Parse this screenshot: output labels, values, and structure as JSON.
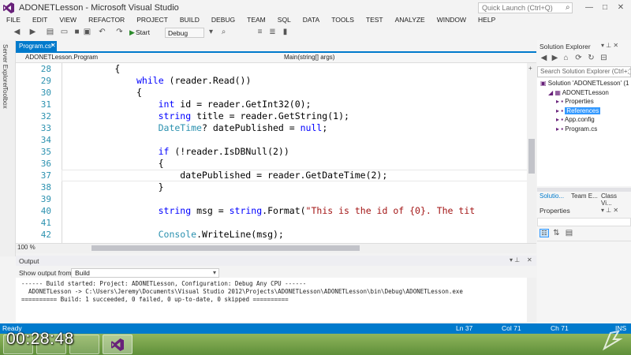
{
  "window": {
    "title": "ADONETLesson - Microsoft Visual Studio",
    "quick_launch_placeholder": "Quick Launch (Ctrl+Q)"
  },
  "menu": [
    "FILE",
    "EDIT",
    "VIEW",
    "REFACTOR",
    "PROJECT",
    "BUILD",
    "DEBUG",
    "TEAM",
    "SQL",
    "DATA",
    "TOOLS",
    "TEST",
    "ANALYZE",
    "WINDOW",
    "HELP"
  ],
  "toolbar": {
    "start_label": "Start",
    "config": "Debug"
  },
  "side_tabs": [
    "Server Explorer",
    "Toolbox"
  ],
  "editor": {
    "tab_label": "Program.cs*",
    "nav_left": "ADONETLesson.Program",
    "nav_right": "Main(string[] args)",
    "zoom": "100 %",
    "lines": [
      {
        "num": "28",
        "indent": 4,
        "parts": [
          {
            "t": "{",
            "c": "p"
          }
        ]
      },
      {
        "num": "29",
        "indent": 5,
        "parts": [
          {
            "t": "while",
            "c": "kw"
          },
          {
            "t": " (reader.Read())",
            "c": "p"
          }
        ]
      },
      {
        "num": "30",
        "indent": 5,
        "parts": [
          {
            "t": "{",
            "c": "p"
          }
        ]
      },
      {
        "num": "31",
        "indent": 6,
        "parts": [
          {
            "t": "int",
            "c": "kw"
          },
          {
            "t": " id = reader.GetInt32(0);",
            "c": "p"
          }
        ]
      },
      {
        "num": "32",
        "indent": 6,
        "parts": [
          {
            "t": "string",
            "c": "kw"
          },
          {
            "t": " title = reader.GetString(1);",
            "c": "p"
          }
        ]
      },
      {
        "num": "33",
        "indent": 6,
        "parts": [
          {
            "t": "DateTime",
            "c": "ty"
          },
          {
            "t": "? datePublished = ",
            "c": "p"
          },
          {
            "t": "null",
            "c": "kw"
          },
          {
            "t": ";",
            "c": "p"
          }
        ]
      },
      {
        "num": "34",
        "indent": 6,
        "parts": []
      },
      {
        "num": "35",
        "indent": 6,
        "parts": [
          {
            "t": "if",
            "c": "kw"
          },
          {
            "t": " (!reader.IsDBNull(2))",
            "c": "p"
          }
        ]
      },
      {
        "num": "36",
        "indent": 6,
        "parts": [
          {
            "t": "{",
            "c": "p"
          }
        ]
      },
      {
        "num": "37",
        "indent": 7,
        "parts": [
          {
            "t": "datePublished = reader.GetDateTime(2);",
            "c": "p"
          }
        ]
      },
      {
        "num": "38",
        "indent": 6,
        "parts": [
          {
            "t": "}",
            "c": "p"
          }
        ]
      },
      {
        "num": "39",
        "indent": 6,
        "parts": []
      },
      {
        "num": "40",
        "indent": 6,
        "parts": [
          {
            "t": "string",
            "c": "kw"
          },
          {
            "t": " msg = ",
            "c": "p"
          },
          {
            "t": "string",
            "c": "kw"
          },
          {
            "t": ".Format(",
            "c": "p"
          },
          {
            "t": "\"This is the id of {0}. The tit",
            "c": "str"
          }
        ]
      },
      {
        "num": "41",
        "indent": 6,
        "parts": []
      },
      {
        "num": "42",
        "indent": 6,
        "parts": [
          {
            "t": "Console",
            "c": "ty"
          },
          {
            "t": ".WriteLine(msg);",
            "c": "p"
          }
        ]
      }
    ]
  },
  "output": {
    "title": "Output",
    "show_label": "Show output from:",
    "source": "Build",
    "lines": [
      "------ Build started: Project: ADONETLesson, Configuration: Debug Any CPU ------",
      "  ADONETLesson -> C:\\Users\\Jeremy\\Documents\\Visual Studio 2012\\Projects\\ADONETLesson\\ADONETLesson\\bin\\Debug\\ADONETLesson.exe",
      "========== Build: 1 succeeded, 0 failed, 0 up-to-date, 0 skipped =========="
    ]
  },
  "solution_explorer": {
    "title": "Solution Explorer",
    "search_placeholder": "Search Solution Explorer (Ctrl+;)",
    "items": [
      {
        "label": "Solution 'ADONETLesson' (1",
        "level": 0,
        "selected": false
      },
      {
        "label": "ADONETLesson",
        "level": 1,
        "selected": false
      },
      {
        "label": "Properties",
        "level": 2,
        "selected": false
      },
      {
        "label": "References",
        "level": 2,
        "selected": true
      },
      {
        "label": "App.config",
        "level": 2,
        "selected": false
      },
      {
        "label": "Program.cs",
        "level": 2,
        "selected": false
      }
    ],
    "tabs": [
      "Solutio...",
      "Team E...",
      "Class Vi..."
    ]
  },
  "properties": {
    "title": "Properties"
  },
  "status": {
    "ready": "Ready",
    "ln": "Ln 37",
    "col": "Col 71",
    "ch": "Ch 71",
    "ins": "INS"
  },
  "overlay": {
    "timer": "00:28:48"
  },
  "colors": {
    "accent": "#007acc",
    "keyword": "#0000ff",
    "type": "#2b91af",
    "string": "#a31515",
    "line_number": "#2b91af"
  }
}
